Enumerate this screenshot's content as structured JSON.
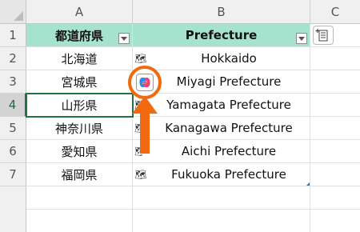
{
  "columns": [
    "A",
    "B",
    "C"
  ],
  "rows": [
    "1",
    "2",
    "3",
    "4",
    "5",
    "6",
    "7"
  ],
  "table": {
    "headers": [
      "都道府県",
      "Prefecture"
    ],
    "data": [
      {
        "pref_jp": "北海道",
        "pref_en": "Hokkaido"
      },
      {
        "pref_jp": "宮城県",
        "pref_en": "Miyagi Prefecture"
      },
      {
        "pref_jp": "山形県",
        "pref_en": "Yamagata Prefecture"
      },
      {
        "pref_jp": "神奈川県",
        "pref_en": "Kanagawa Prefecture"
      },
      {
        "pref_jp": "愛知県",
        "pref_en": "Aichi Prefecture"
      },
      {
        "pref_jp": "福岡県",
        "pref_en": "Fukuoka Prefecture"
      }
    ]
  },
  "colors": {
    "header_fill": "#a6e3cf",
    "highlight": "#f26a10",
    "selection": "#217346"
  },
  "icons": {
    "geography": "map-icon",
    "copilot": "copilot-icon",
    "quick_analysis": "insert-data-icon",
    "filter": "filter-dropdown-icon"
  }
}
